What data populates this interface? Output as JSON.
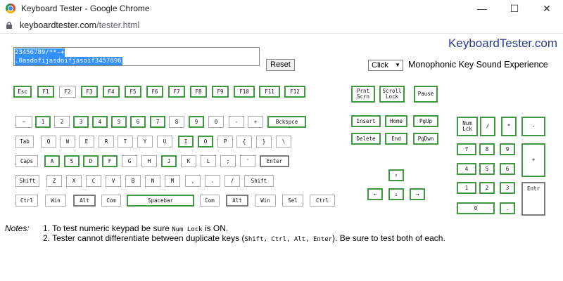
{
  "browser": {
    "title": "Keyboard Tester - Google Chrome",
    "url_host": "keyboardtester.com",
    "url_path": "/tester.html",
    "buttons": {
      "minimize": "—",
      "maximize": "☐",
      "close": "✕"
    }
  },
  "brand": "KeyboardTester.com",
  "textarea": {
    "line1": "23456789/**-+",
    "line2": ".0asdofijasdoifjasoif3457696"
  },
  "reset_label": "Reset",
  "sound": {
    "selected": "Click",
    "label": "Monophonic Key Sound Experience"
  },
  "keys": [
    {
      "id": "esc",
      "label": "Esc",
      "pressed": true
    },
    {
      "id": "f1",
      "label": "F1",
      "pressed": true
    },
    {
      "id": "f2",
      "label": "F2",
      "pressed": false
    },
    {
      "id": "f3",
      "label": "F3",
      "pressed": true
    },
    {
      "id": "f4",
      "label": "F4",
      "pressed": true
    },
    {
      "id": "f5",
      "label": "F5",
      "pressed": true
    },
    {
      "id": "f6",
      "label": "F6",
      "pressed": true
    },
    {
      "id": "f7",
      "label": "F7",
      "pressed": true
    },
    {
      "id": "f8",
      "label": "F8",
      "pressed": true
    },
    {
      "id": "f9",
      "label": "F9",
      "pressed": true
    },
    {
      "id": "f10",
      "label": "F10",
      "pressed": true
    },
    {
      "id": "f11",
      "label": "F11",
      "pressed": true
    },
    {
      "id": "f12",
      "label": "F12",
      "pressed": true
    },
    {
      "id": "prntscrn",
      "label": "Prnt\nScrn",
      "pressed": true
    },
    {
      "id": "scrolllock",
      "label": "Scroll\nLock",
      "pressed": true
    },
    {
      "id": "pause",
      "label": "Pause",
      "pressed": true
    },
    {
      "id": "tilde",
      "label": "~",
      "pressed": false
    },
    {
      "id": "1",
      "label": "1",
      "pressed": true
    },
    {
      "id": "2",
      "label": "2",
      "pressed": false
    },
    {
      "id": "3",
      "label": "3",
      "pressed": true
    },
    {
      "id": "4",
      "label": "4",
      "pressed": true
    },
    {
      "id": "5",
      "label": "5",
      "pressed": true
    },
    {
      "id": "6",
      "label": "6",
      "pressed": true
    },
    {
      "id": "7",
      "label": "7",
      "pressed": true
    },
    {
      "id": "8",
      "label": "8",
      "pressed": false
    },
    {
      "id": "9",
      "label": "9",
      "pressed": true
    },
    {
      "id": "0",
      "label": "0",
      "pressed": false
    },
    {
      "id": "minus",
      "label": "-",
      "pressed": false
    },
    {
      "id": "plus",
      "label": "+",
      "pressed": false
    },
    {
      "id": "backspace",
      "label": "Bckspce",
      "pressed": true
    },
    {
      "id": "tab",
      "label": "Tab",
      "pressed": false
    },
    {
      "id": "q",
      "label": "Q",
      "pressed": false
    },
    {
      "id": "w",
      "label": "W",
      "pressed": false
    },
    {
      "id": "e",
      "label": "E",
      "pressed": false
    },
    {
      "id": "r",
      "label": "R",
      "pressed": false
    },
    {
      "id": "t",
      "label": "T",
      "pressed": false
    },
    {
      "id": "y",
      "label": "Y",
      "pressed": false
    },
    {
      "id": "u",
      "label": "U",
      "pressed": false
    },
    {
      "id": "i",
      "label": "I",
      "pressed": true
    },
    {
      "id": "o",
      "label": "O",
      "pressed": true
    },
    {
      "id": "p",
      "label": "P",
      "pressed": false
    },
    {
      "id": "lbrace",
      "label": "{",
      "pressed": false
    },
    {
      "id": "rbrace",
      "label": "}",
      "pressed": false
    },
    {
      "id": "backslash",
      "label": "\\",
      "pressed": false
    },
    {
      "id": "caps",
      "label": "Caps",
      "pressed": false
    },
    {
      "id": "a",
      "label": "A",
      "pressed": true
    },
    {
      "id": "s",
      "label": "S",
      "pressed": true
    },
    {
      "id": "d",
      "label": "D",
      "pressed": true
    },
    {
      "id": "f",
      "label": "F",
      "pressed": true
    },
    {
      "id": "g",
      "label": "G",
      "pressed": false
    },
    {
      "id": "h",
      "label": "H",
      "pressed": false
    },
    {
      "id": "j",
      "label": "J",
      "pressed": true
    },
    {
      "id": "k",
      "label": "K",
      "pressed": false
    },
    {
      "id": "l",
      "label": "L",
      "pressed": false
    },
    {
      "id": "semicolon",
      "label": ";",
      "pressed": false
    },
    {
      "id": "quote",
      "label": "'",
      "pressed": false
    },
    {
      "id": "enter",
      "label": "Enter",
      "pressed": "dark"
    },
    {
      "id": "lshift",
      "label": "Shift",
      "pressed": false
    },
    {
      "id": "z",
      "label": "Z",
      "pressed": false
    },
    {
      "id": "x",
      "label": "X",
      "pressed": false
    },
    {
      "id": "c",
      "label": "C",
      "pressed": false
    },
    {
      "id": "v",
      "label": "V",
      "pressed": false
    },
    {
      "id": "b",
      "label": "B",
      "pressed": false
    },
    {
      "id": "n",
      "label": "N",
      "pressed": false
    },
    {
      "id": "m",
      "label": "M",
      "pressed": false
    },
    {
      "id": "comma",
      "label": ",",
      "pressed": false
    },
    {
      "id": "period",
      "label": ".",
      "pressed": false
    },
    {
      "id": "slash",
      "label": "/",
      "pressed": false
    },
    {
      "id": "rshift",
      "label": "Shift",
      "pressed": false
    },
    {
      "id": "lctrl",
      "label": "Ctrl",
      "pressed": false
    },
    {
      "id": "lwin",
      "label": "Win",
      "pressed": false
    },
    {
      "id": "lalt",
      "label": "Alt",
      "pressed": "dark"
    },
    {
      "id": "lcom",
      "label": "Com",
      "pressed": false
    },
    {
      "id": "space",
      "label": "Spacebar",
      "pressed": true
    },
    {
      "id": "rcom",
      "label": "Com",
      "pressed": false
    },
    {
      "id": "ralt",
      "label": "Alt",
      "pressed": "dark"
    },
    {
      "id": "rwin",
      "label": "Win",
      "pressed": false
    },
    {
      "id": "sel",
      "label": "Sel",
      "pressed": false
    },
    {
      "id": "rctrl",
      "label": "Ctrl",
      "pressed": false
    },
    {
      "id": "insert",
      "label": "Insert",
      "pressed": true
    },
    {
      "id": "home",
      "label": "Home",
      "pressed": true
    },
    {
      "id": "pgup",
      "label": "PgUp",
      "pressed": true
    },
    {
      "id": "delete",
      "label": "Delete",
      "pressed": true
    },
    {
      "id": "end",
      "label": "End",
      "pressed": true
    },
    {
      "id": "pgdn",
      "label": "PgDwn",
      "pressed": true
    },
    {
      "id": "up",
      "label": "↑",
      "pressed": true
    },
    {
      "id": "left",
      "label": "←",
      "pressed": true
    },
    {
      "id": "down",
      "label": "↓",
      "pressed": true
    },
    {
      "id": "right",
      "label": "→",
      "pressed": true
    },
    {
      "id": "numlock",
      "label": "Num\nLck",
      "pressed": true
    },
    {
      "id": "numdiv",
      "label": "/",
      "pressed": true
    },
    {
      "id": "nummul",
      "label": "*",
      "pressed": true
    },
    {
      "id": "numminus",
      "label": "-",
      "pressed": true
    },
    {
      "id": "num7",
      "label": "7",
      "pressed": true
    },
    {
      "id": "num8",
      "label": "8",
      "pressed": true
    },
    {
      "id": "num9",
      "label": "9",
      "pressed": true
    },
    {
      "id": "numplus",
      "label": "+",
      "pressed": true
    },
    {
      "id": "num4",
      "label": "4",
      "pressed": true
    },
    {
      "id": "num5",
      "label": "5",
      "pressed": true
    },
    {
      "id": "num6",
      "label": "6",
      "pressed": true
    },
    {
      "id": "num1",
      "label": "1",
      "pressed": true
    },
    {
      "id": "num2",
      "label": "2",
      "pressed": true
    },
    {
      "id": "num3",
      "label": "3",
      "pressed": true
    },
    {
      "id": "numenter",
      "label": "Entr",
      "pressed": "dark"
    },
    {
      "id": "num0",
      "label": "0",
      "pressed": true
    },
    {
      "id": "numdot",
      "label": ".",
      "pressed": true
    }
  ],
  "notes": {
    "label": "Notes:",
    "line1_pre": "1. To test numeric keypad be sure ",
    "line1_code": "Num Lock",
    "line1_post": " is ON.",
    "line2_pre": "2. Tester cannot differentiate between duplicate keys (",
    "line2_code": "Shift, Ctrl, Alt, Enter",
    "line2_post": "). Be sure to test both of each."
  }
}
